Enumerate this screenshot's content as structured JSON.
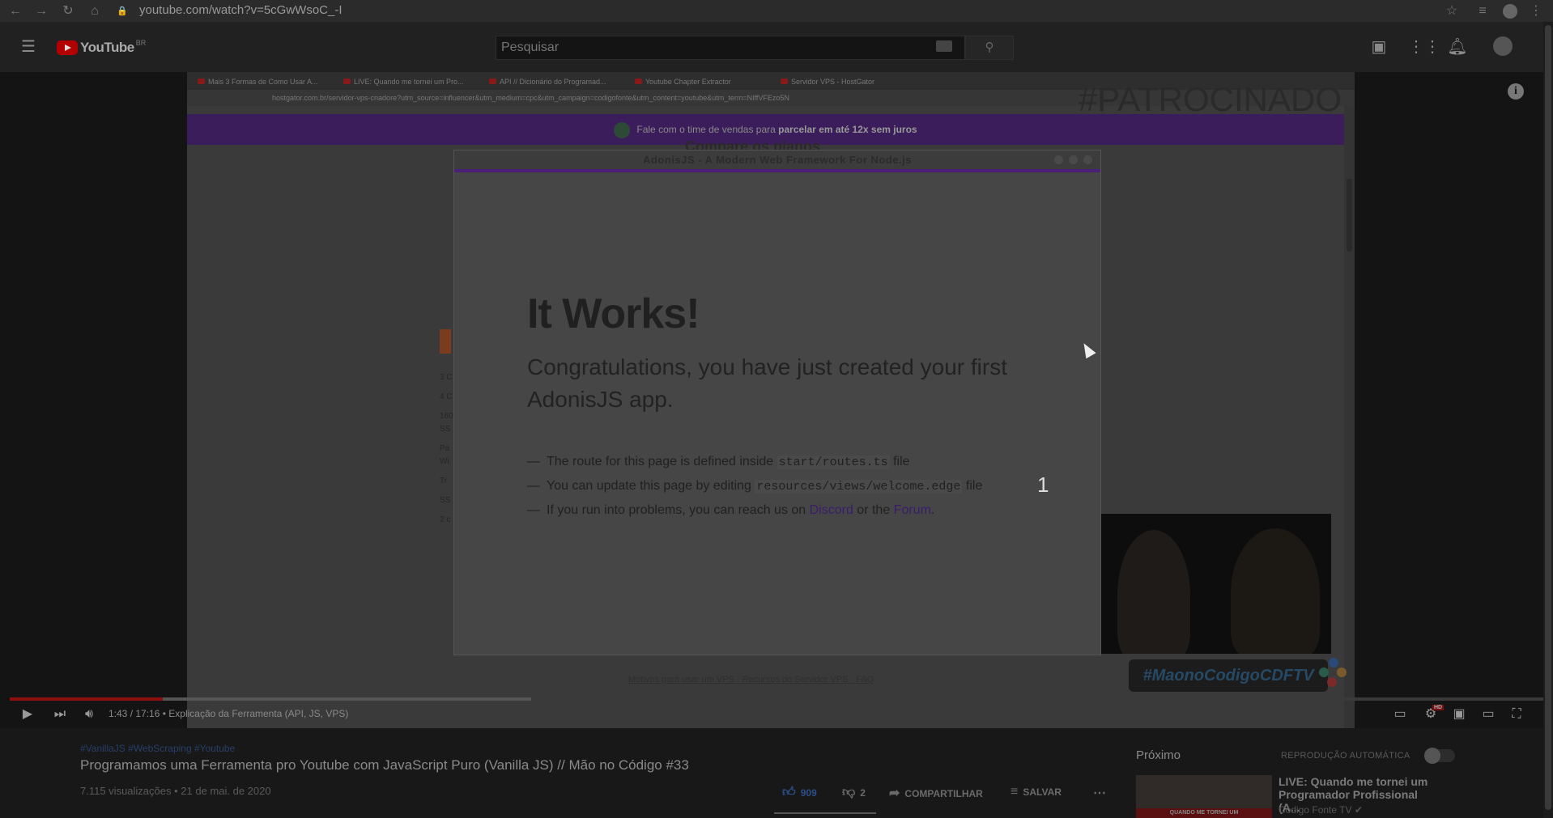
{
  "browser": {
    "url": "youtube.com/watch?v=5cGwWsoC_-I"
  },
  "masthead": {
    "logo_text": "YouTube",
    "logo_region": "BR",
    "search_placeholder": "Pesquisar"
  },
  "video": {
    "tabs": [
      "Mais 3 Formas de Como Usar A...",
      "LIVE: Quando me tornei um Pro...",
      "API // Dicionário do Programad...",
      "Youtube Chapter Extractor",
      "Servidor VPS - HostGator"
    ],
    "address": "hostgator.com.br/servidor-vps-cnadore?utm_source=influencer&utm_medium=cpc&utm_campaign=codigofonte&utm_content=youtube&utm_term=NIffVFEzo5N",
    "sponsor_tag": "#PATROCINADO",
    "banner_text": "Fale com o time de vendas para ",
    "banner_bold": "parcelar em até 12x sem juros",
    "bg_heading": "Compare os planos",
    "bg_lines": [
      "3 C",
      "4 C",
      "160",
      "SS",
      "Pa",
      "Wi",
      "Tr",
      "SS",
      "2 c"
    ],
    "footer_links": "Motivos para usar um VPS · Recursos do Servidor VPS · FAQ",
    "modal": {
      "title": "AdonisJS - A Modern Web Framework For Node.js",
      "headline": "It Works!",
      "subhead": "Congratulations, you have just created your first AdonisJS app.",
      "hints": [
        {
          "pre": "The route for this page is defined inside ",
          "code": "start/routes.ts",
          "post": " file"
        },
        {
          "pre": "You can update this page by editing ",
          "code": "resources/views/welcome.edge",
          "post": " file"
        }
      ],
      "hint3_pre": "If you run into problems, you can reach us on ",
      "hint3_link1": "Discord",
      "hint3_mid": " or the ",
      "hint3_link2": "Forum",
      "hint3_post": "."
    },
    "chapter_number": "1",
    "webcam_tag": "#MaonoCodigoCDFTV"
  },
  "player": {
    "time": "1:43 / 17:16",
    "chapter": "• Explicação da Ferramenta (API, JS, VPS)",
    "played_fraction": 0.1,
    "loaded_fraction": 0.34,
    "hd_badge": "HD"
  },
  "details": {
    "tags": "#VanillaJS #WebScraping #Youtube",
    "title": "Programamos uma Ferramenta pro Youtube com JavaScript Puro (Vanilla JS) // Mão no Código #33",
    "views": "7.115 visualizações • 21 de mai. de 2020",
    "likes": "909",
    "dislikes": "2",
    "share": "COMPARTILHAR",
    "save": "SALVAR"
  },
  "upnext": {
    "heading": "Próximo",
    "autoplay": "REPRODUÇÃO AUTOMÁTICA",
    "title": "LIVE: Quando me tornei um Programador Profissional (A...",
    "channel": "Código Fonte TV ✔",
    "thumb_caption": "QUANDO ME TORNEI UM"
  }
}
